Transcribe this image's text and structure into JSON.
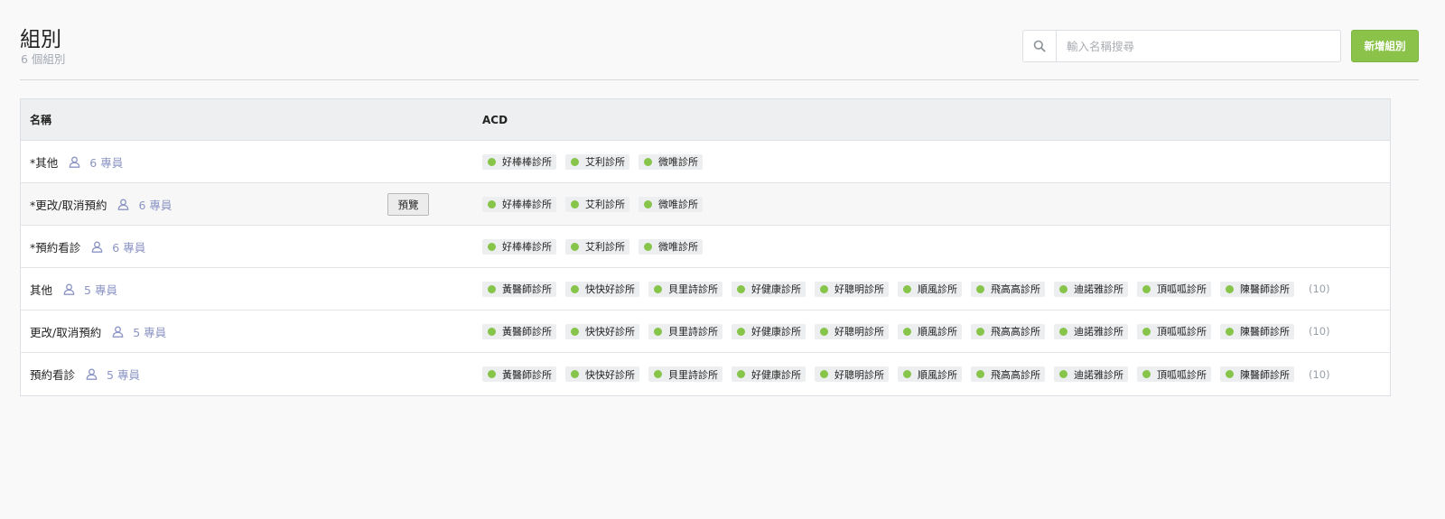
{
  "header": {
    "title": "組別",
    "subtitle": "6 個組別",
    "search_placeholder": "輸入名稱搜尋",
    "add_button_label": "新增組別"
  },
  "table": {
    "columns": {
      "name": "名稱",
      "acd": "ACD"
    },
    "rows": [
      {
        "name": "*其他",
        "members": "6 專員",
        "preview": null,
        "clinics": [
          "好棒棒診所",
          "艾利診所",
          "微唯診所"
        ],
        "count": null
      },
      {
        "name": "*更改/取消預約",
        "members": "6 專員",
        "preview": "預覽",
        "clinics": [
          "好棒棒診所",
          "艾利診所",
          "微唯診所"
        ],
        "count": null
      },
      {
        "name": "*預約看診",
        "members": "6 專員",
        "preview": null,
        "clinics": [
          "好棒棒診所",
          "艾利診所",
          "微唯診所"
        ],
        "count": null
      },
      {
        "name": "其他",
        "members": "5 專員",
        "preview": null,
        "clinics": [
          "黃醫師診所",
          "快快好診所",
          "貝里詩診所",
          "好健康診所",
          "好聰明診所",
          "順風診所",
          "飛高高診所",
          "迪諾雅診所",
          "頂呱呱診所",
          "陳醫師診所"
        ],
        "count": "(10)"
      },
      {
        "name": "更改/取消預約",
        "members": "5 專員",
        "preview": null,
        "clinics": [
          "黃醫師診所",
          "快快好診所",
          "貝里詩診所",
          "好健康診所",
          "好聰明診所",
          "順風診所",
          "飛高高診所",
          "迪諾雅診所",
          "頂呱呱診所",
          "陳醫師診所"
        ],
        "count": "(10)"
      },
      {
        "name": "預約看診",
        "members": "5 專員",
        "preview": null,
        "clinics": [
          "黃醫師診所",
          "快快好診所",
          "貝里詩診所",
          "好健康診所",
          "好聰明診所",
          "順風診所",
          "飛高高診所",
          "迪諾雅診所",
          "頂呱呱診所",
          "陳醫師診所"
        ],
        "count": "(10)"
      }
    ]
  },
  "icons": {
    "search": "search-icon",
    "member": "user-icon",
    "status_dot": "status-dot-icon"
  },
  "colors": {
    "accent": "#8bc34a",
    "status_dot": "#86c54a",
    "member_link": "#8c95c4"
  }
}
